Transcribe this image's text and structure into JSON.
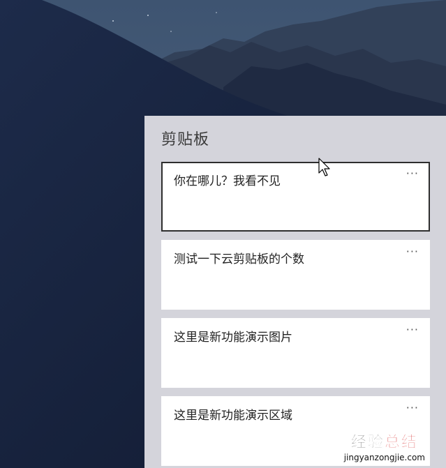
{
  "panel": {
    "title": "剪贴板"
  },
  "clips": [
    {
      "text": "你在哪儿？我看不见",
      "more_label": "···",
      "selected": true
    },
    {
      "text": "测试一下云剪贴板的个数",
      "more_label": "···",
      "selected": false
    },
    {
      "text": "这里是新功能演示图片",
      "more_label": "···",
      "selected": false
    },
    {
      "text": "这里是新功能演示区域",
      "more_label": "···",
      "selected": false
    }
  ],
  "watermark": {
    "main_part1": "经验",
    "main_part2": "总结",
    "sub": "jingyanzongjie.com"
  },
  "colors": {
    "panel_bg": "#d4d4db",
    "card_bg": "#ffffff",
    "sky_top": "#3f5470",
    "desert_dark": "#16203a"
  }
}
